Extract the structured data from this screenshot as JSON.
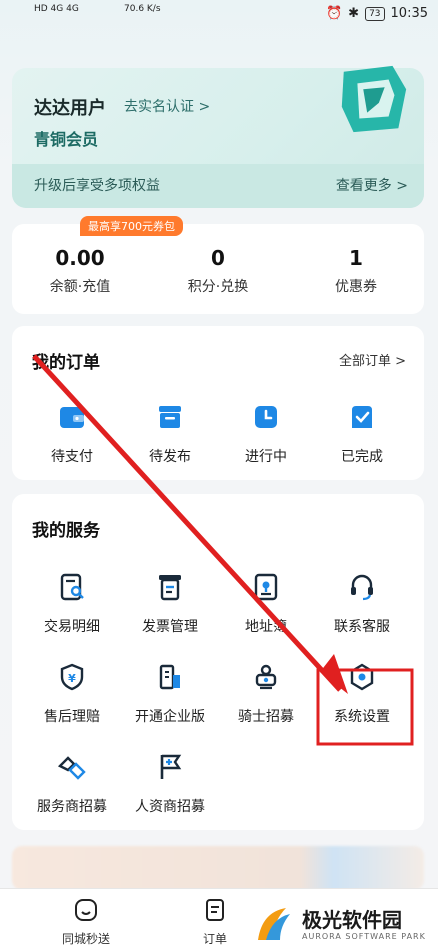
{
  "status": {
    "network_left": "HD 4G 4G",
    "speed": "70.6 K/s",
    "battery": "73",
    "time": "10:35"
  },
  "member": {
    "name": "达达用户",
    "auth_link": "去实名认证 >",
    "level": "青铜会员",
    "upgrade_tip": "升级后享受多项权益",
    "view_more": "查看更多 >"
  },
  "assets": {
    "promo": "最高享700元券包",
    "items": [
      {
        "value": "0.00",
        "label": "余额·充值"
      },
      {
        "value": "0",
        "label": "积分·兑换"
      },
      {
        "value": "1",
        "label": "优惠券"
      }
    ]
  },
  "orders": {
    "title": "我的订单",
    "all_link": "全部订单 >",
    "items": [
      {
        "label": "待支付",
        "icon": "wallet-icon"
      },
      {
        "label": "待发布",
        "icon": "inbox-icon"
      },
      {
        "label": "进行中",
        "icon": "clock-icon"
      },
      {
        "label": "已完成",
        "icon": "check-icon"
      }
    ]
  },
  "services": {
    "title": "我的服务",
    "items": [
      {
        "label": "交易明细",
        "icon": "receipt-search-icon"
      },
      {
        "label": "发票管理",
        "icon": "invoice-icon"
      },
      {
        "label": "地址簿",
        "icon": "address-book-icon"
      },
      {
        "label": "联系客服",
        "icon": "headset-icon"
      },
      {
        "label": "售后理赔",
        "icon": "shield-yen-icon"
      },
      {
        "label": "开通企业版",
        "icon": "building-icon"
      },
      {
        "label": "骑士招募",
        "icon": "rider-icon"
      },
      {
        "label": "系统设置",
        "icon": "settings-icon"
      },
      {
        "label": "服务商招募",
        "icon": "handshake-icon"
      },
      {
        "label": "人资商招募",
        "icon": "flag-icon"
      }
    ]
  },
  "tabbar": {
    "items": [
      {
        "label": "同城秒送",
        "icon": "smile-icon"
      },
      {
        "label": "订单",
        "icon": "order-icon"
      }
    ]
  },
  "watermark": {
    "title": "极光软件园",
    "subtitle": "AURORA SOFTWARE PARK"
  },
  "colors": {
    "accent": "#1e88e5",
    "brand_teal": "#23b3a6",
    "promo": "#ff7a2d",
    "annotation": "#e02020"
  }
}
